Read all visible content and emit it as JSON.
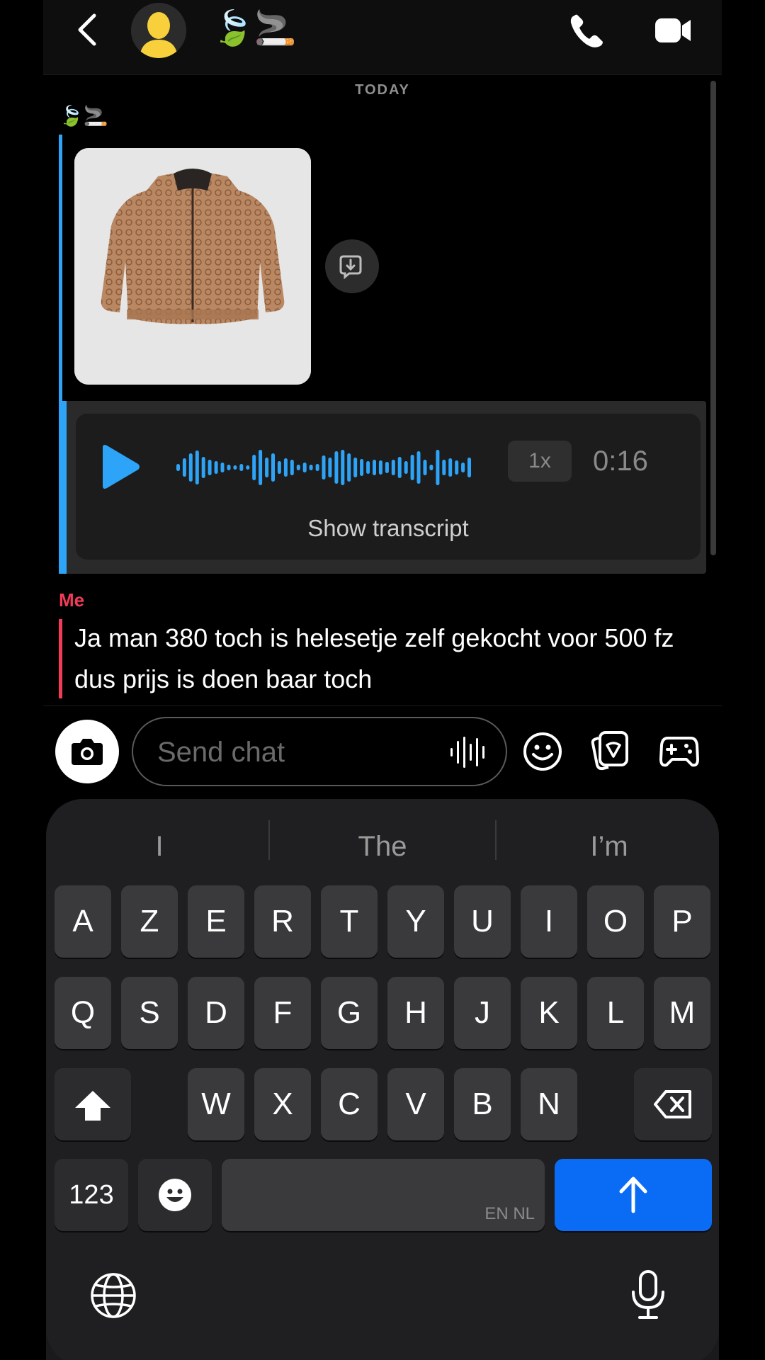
{
  "header": {
    "chat_name": "🍃🚬",
    "back_icon": "chevron-left-icon",
    "avatar_icon": "bitmoji-avatar-placeholder",
    "call_icon": "phone-icon",
    "video_icon": "video-camera-icon"
  },
  "conversation": {
    "date_separator": "TODAY",
    "sender_name": "🍃🚬",
    "image_message": {
      "description_icon": "jacket-photo",
      "save_icon": "save-to-chat-icon"
    },
    "voice_message": {
      "speed": "1x",
      "duration": "0:16",
      "transcript_label": "Show transcript",
      "accent": "#2da4f7"
    },
    "my_message": {
      "sender": "Me",
      "text": "Ja man 380 toch is helesetje zelf gekocht voor 500 fz dus prijs is doen baar toch",
      "accent": "#f23c57"
    }
  },
  "chat_input": {
    "placeholder": "Send chat",
    "camera_icon": "camera-icon",
    "voice_icon": "voice-waveform-icon",
    "emoji_icon": "smiley-icon",
    "sticker_icon": "sticker-icon",
    "game_icon": "gamepad-icon"
  },
  "keyboard": {
    "suggestions": [
      "I",
      "The",
      "I’m"
    ],
    "row1": [
      "A",
      "Z",
      "E",
      "R",
      "T",
      "Y",
      "U",
      "I",
      "O",
      "P"
    ],
    "row2": [
      "Q",
      "S",
      "D",
      "F",
      "G",
      "H",
      "J",
      "K",
      "L",
      "M"
    ],
    "row3": [
      "W",
      "X",
      "C",
      "V",
      "B",
      "N"
    ],
    "numbers_key": "123",
    "space_languages": "EN NL",
    "return_color": "#0a6cf5"
  }
}
